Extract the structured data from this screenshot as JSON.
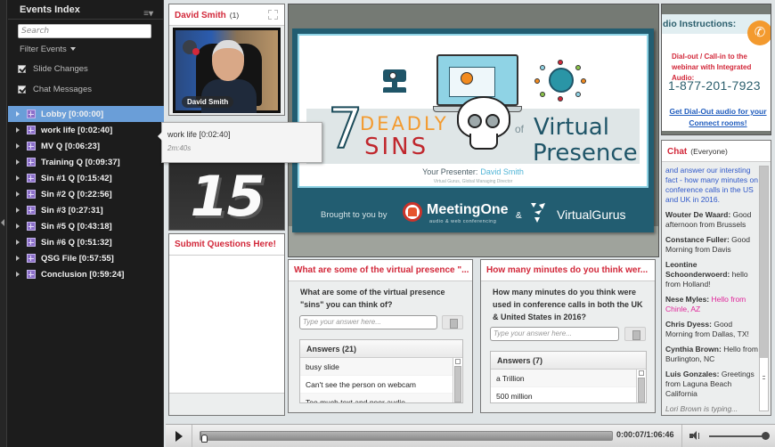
{
  "sidebar": {
    "title": "Events Index",
    "menu_icon": "≡▾",
    "search_placeholder": "Search",
    "filter_label": "Filter Events",
    "filters": [
      {
        "label": "Slide Changes",
        "checked": true
      },
      {
        "label": "Chat Messages",
        "checked": true
      }
    ],
    "events": [
      {
        "label": "Lobby [0:00:00]",
        "selected": true
      },
      {
        "label": "work life [0:02:40]",
        "selected": false
      },
      {
        "label": "MV Q [0:06:23]",
        "selected": false
      },
      {
        "label": "Training Q [0:09:37]",
        "selected": false
      },
      {
        "label": "Sin #1 Q [0:15:42]",
        "selected": false
      },
      {
        "label": "Sin #2 Q [0:22:56]",
        "selected": false
      },
      {
        "label": "Sin #3 [0:27:31]",
        "selected": false
      },
      {
        "label": "Sin #5 Q [0:43:18]",
        "selected": false
      },
      {
        "label": "Sin #6 Q [0:51:32]",
        "selected": false
      },
      {
        "label": "QSG File [0:57:55]",
        "selected": false
      },
      {
        "label": "Conclusion [0:59:24]",
        "selected": false
      }
    ]
  },
  "tooltip": {
    "title": "work life [0:02:40]",
    "duration": "2m:40s"
  },
  "video_pod": {
    "title": "David Smith",
    "count": "(1)",
    "participant_name": "David Smith"
  },
  "counter_pod": {
    "value": "15"
  },
  "qa_pod": {
    "title": "Submit Questions Here!"
  },
  "slide": {
    "number": "7",
    "word_deadly": "DEADLY",
    "word_sins": "SINS",
    "word_of": "of",
    "word_virtual": "Virtual",
    "word_presence": "Presence",
    "presenter_label": "Your Presenter:",
    "presenter_name": "David Smith",
    "presenter_role": "Virtual Gurus, Global Managing Director",
    "brought_by": "Brought to you by",
    "sponsor1_name": "MeetingOne",
    "sponsor1_sub": "audio & web conferencing",
    "ampersand": "&",
    "sponsor2_name": "VirtualGurus",
    "colors": {
      "deadly": "#f39a2e",
      "sins": "#c0272d",
      "title": "#1f5568",
      "band": "#225d71"
    }
  },
  "polls": [
    {
      "title": "What are some of the virtual presence \"...",
      "question": "What are some of the virtual presence \"sins\" you can think of?",
      "input_placeholder": "Type your answer here...",
      "answers_header": "Answers (21)",
      "answers": [
        "busy slide",
        "Can't see the person on webcam",
        "Too much text and poor audio"
      ]
    },
    {
      "title": "How many minutes do you think wer...",
      "question": "How many minutes do you think were used in conference calls in both the UK & United States in 2016?",
      "input_placeholder": "Type your answer here...",
      "answers_header": "Answers (7)",
      "answers": [
        "a Trillion",
        "500 million"
      ]
    }
  ],
  "audio_pod": {
    "title": "dio Instructions:",
    "dial_text": "Dial-out / Call-in to the webinar with Integrated Audio:",
    "phone": "1-877-201-7923",
    "link": "Get Dial-Out audio for your Connect rooms!"
  },
  "chat": {
    "title": "Chat",
    "scope": "(Everyone)",
    "intro": "and answer our intersting fact - how many minutes on conference calls in the US and UK in 2016.",
    "messages": [
      {
        "author": "Wouter De Waard:",
        "text": "Good afternoon from Brussels",
        "highlight": false
      },
      {
        "author": "Constance Fuller:",
        "text": "Good Morning from Davis",
        "highlight": false
      },
      {
        "author": "Leontine Schoonderwoerd:",
        "text": "hello from Holland!",
        "highlight": false
      },
      {
        "author": "Nese Myles:",
        "text": "Hello from Chinle, AZ",
        "highlight": true
      },
      {
        "author": "Chris Dyess:",
        "text": "Good Morning from Dallas, TX!",
        "highlight": false
      },
      {
        "author": "Cynthia Brown:",
        "text": "Hello from Burlington, NC",
        "highlight": false
      },
      {
        "author": "Luis Gonzales:",
        "text": "Greetings from Laguna Beach California",
        "highlight": false
      }
    ],
    "typing": "Lori Brown is typing..."
  },
  "playbar": {
    "current_time": "0:00:07",
    "total_time": "1:06:46",
    "time_display": "0:00:07/1:06:46",
    "progress_fraction": 0.0017,
    "volume_fraction": 1.0
  }
}
